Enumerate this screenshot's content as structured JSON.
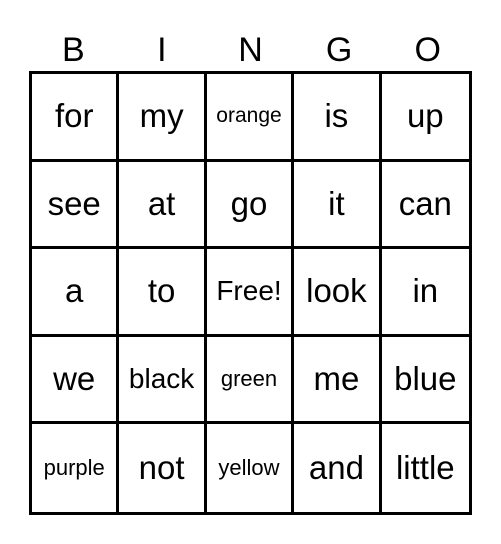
{
  "header": [
    "B",
    "I",
    "N",
    "G",
    "O"
  ],
  "grid": [
    [
      "for",
      "my",
      "orange",
      "is",
      "up"
    ],
    [
      "see",
      "at",
      "go",
      "it",
      "can"
    ],
    [
      "a",
      "to",
      "Free!",
      "look",
      "in"
    ],
    [
      "we",
      "black",
      "green",
      "me",
      "blue"
    ],
    [
      "purple",
      "not",
      "yellow",
      "and",
      "little"
    ]
  ]
}
